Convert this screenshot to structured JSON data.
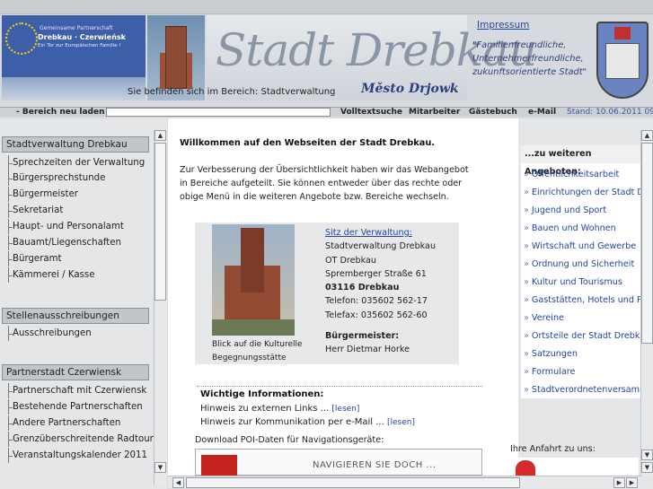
{
  "header": {
    "banner_line1": "Gemeinsame Partnerschaft",
    "banner_line2": "Drebkau · Czerwieńsk",
    "banner_line3": "Ein Tor zur Europäischen Familie !",
    "site_title": "Stadt Drebkau",
    "site_subtitle": "Město Drjowk",
    "breadcrumb": "Sie befinden sich im Bereich: Stadtverwaltung",
    "impressum": "Impressum",
    "motto": [
      "\"Familienfreundliche,",
      "Unternehmerfreundliche,",
      "zukunftsorientierte Stadt\""
    ]
  },
  "toolbar": {
    "bereich": "- Bereich neu laden -",
    "volltext": "Volltextsuche",
    "mitarbeiter": "Mitarbeiter",
    "gaestebuch": "Gästebuch",
    "email": "e-Mail",
    "stand": "Stand: 10.06.2011 09"
  },
  "left_nav": {
    "sections": [
      {
        "title": "Stadtverwaltung Drebkau",
        "items": [
          "Sprechzeiten der Verwaltung",
          "Bürgersprechstunde",
          "Bürgermeister",
          "Sekretariat",
          "Haupt- und Personalamt",
          "Bauamt/Liegenschaften",
          "Bürgeramt",
          "Kämmerei / Kasse"
        ]
      },
      {
        "title": "Stellenausschreibungen",
        "items": [
          "Ausschreibungen"
        ]
      },
      {
        "title": "Partnerstadt Czerwiensk",
        "items": [
          "Partnerschaft mit Czerwiensk",
          "Bestehende Partnerschaften",
          "Andere Partnerschaften",
          "Grenzüberschreitende Radtour",
          "Veranstaltungskalender 2011"
        ]
      }
    ]
  },
  "main": {
    "welcome": "Willkommen auf den Webseiten der Stadt Drebkau.",
    "intro": "Zur Verbesserung der Übersichtlichkeit haben wir das Webangebot in Bereiche aufgeteilt. Sie können entweder über das rechte oder obige Menü in die weiteren Angebote bzw. Bereiche wechseln.",
    "caption1": "Blick auf die Kulturelle",
    "caption2": "Begegnungsstätte",
    "sitz_link": "Sitz der Verwaltung:",
    "addr1": "Stadtverwaltung Drebkau",
    "addr2": "OT Drebkau",
    "addr3": "Spremberger Straße 61",
    "addr4": "03116 Drebkau",
    "telefon": "Telefon: 035602 562-17",
    "telefax": "Telefax: 035602 562-60",
    "bm_label": "Bürgermeister:",
    "bm_name": "Herr Dietmar Horke",
    "wichtig_title": "Wichtige Informationen:",
    "hinweis1": "Hinweis zu externen Links ...",
    "hinweis2": "Hinweis zur Kommunikation per e-Mail ...",
    "lesen": "[lesen]",
    "poi": "Download POI-Daten für Navigationsgeräte:",
    "poi_banner": "NAVIGIEREN SIE DOCH ..."
  },
  "right": {
    "title": "...zu weiteren Angeboten:",
    "items": [
      "Öffentlichkeitsarbeit",
      "Einrichtungen der Stadt Drebkau",
      "Jugend und Sport",
      "Bauen und Wohnen",
      "Wirtschaft und Gewerbe",
      "Ordnung und Sicherheit",
      "Kultur und Tourismus",
      "Gaststätten, Hotels und Pensionen",
      "Vereine",
      "Ortsteile der Stadt Drebkau",
      "Satzungen",
      "Formulare",
      "Stadtverordnetenversammlung"
    ],
    "anfahrt": "Ihre Anfahrt zu uns:"
  }
}
